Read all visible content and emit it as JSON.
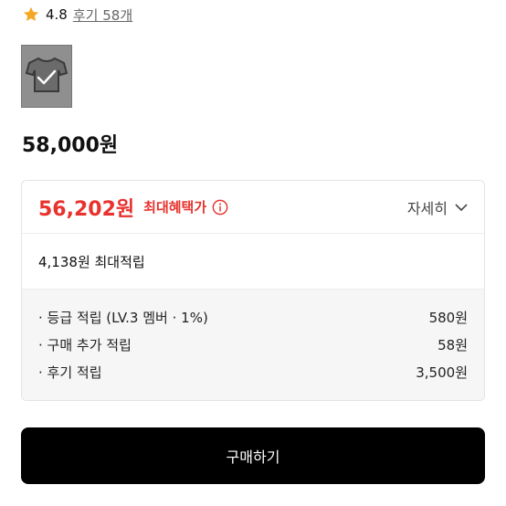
{
  "rating": {
    "value": "4.8",
    "review_link": "후기 58개",
    "star_color": "#f5a623"
  },
  "product": {
    "thumbnail_icon": "tshirt-with-check-icon",
    "price": "58,000원"
  },
  "benefit": {
    "max_price": "56,202원",
    "max_label": "최대혜택가",
    "detail_label": "자세히",
    "accent_color": "#e8322d",
    "points_summary": "4,138원 최대적립",
    "breakdown": [
      {
        "label": "· 등급 적립 (LV.3 멤버 · 1%)",
        "value": "580원"
      },
      {
        "label": "· 구매 추가 적립",
        "value": "58원"
      },
      {
        "label": "· 후기 적립",
        "value": "3,500원"
      }
    ]
  },
  "buy_button": {
    "label": "구매하기"
  }
}
